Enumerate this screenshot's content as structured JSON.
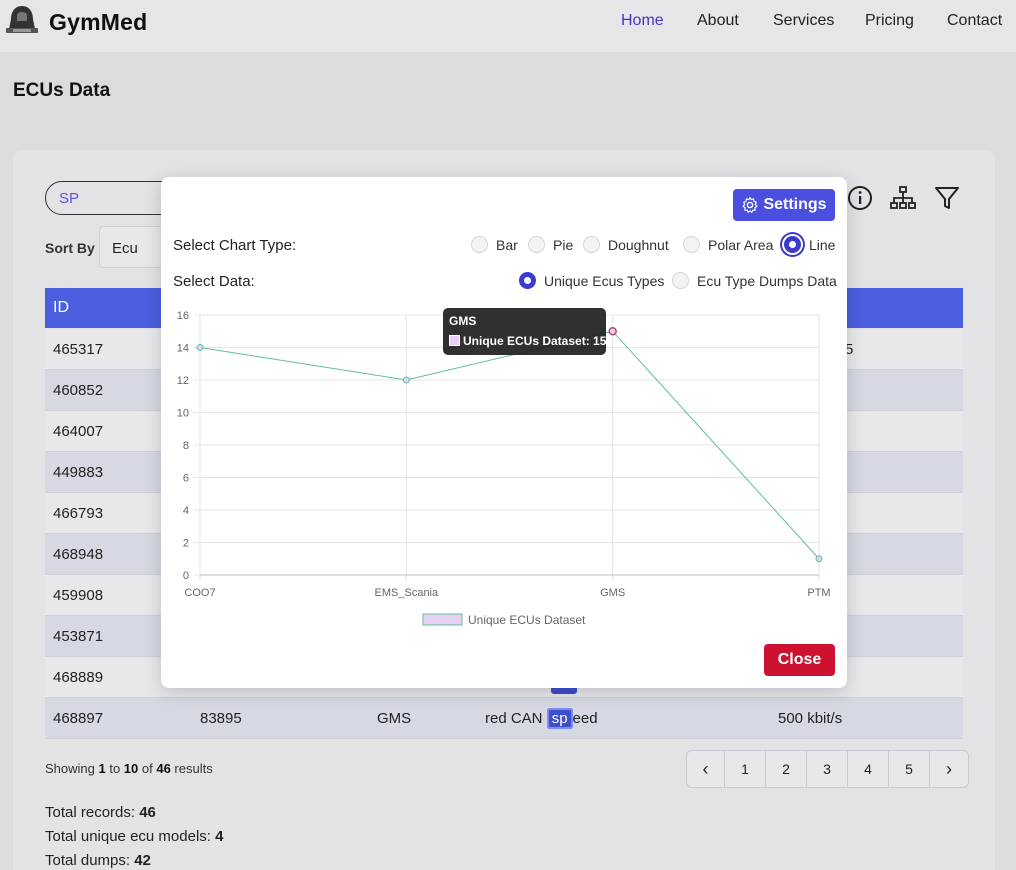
{
  "navbar": {
    "brand": "GymMed",
    "links": [
      "Home",
      "About",
      "Services",
      "Pricing",
      "Contact"
    ],
    "active": "Home"
  },
  "page": {
    "title": "ECUs Data"
  },
  "search": {
    "value": "SP"
  },
  "sort": {
    "label": "Sort By",
    "value": "Ecu"
  },
  "table": {
    "header_id": "ID",
    "rows": [
      {
        "id": "465317"
      },
      {
        "id": "460852"
      },
      {
        "id": "464007"
      },
      {
        "id": "449883"
      },
      {
        "id": "466793"
      },
      {
        "id": "468948"
      },
      {
        "id": "459908"
      },
      {
        "id": "453871"
      },
      {
        "id": "468889"
      },
      {
        "id": "468897",
        "col2": "83895",
        "ecu": "GMS",
        "desc_pre": "red CAN ",
        "desc_hl": "sp",
        "desc_post": "eed",
        "speed": "500 kbit/s"
      }
    ],
    "peek": {
      "row0": "5"
    }
  },
  "pagination": {
    "showing_prefix": "Showing ",
    "from": "1",
    "to_word": " to ",
    "to": "10",
    "of_word": " of ",
    "total": "46",
    "suffix": " results",
    "pages": [
      "1",
      "2",
      "3",
      "4",
      "5"
    ],
    "prev": "‹",
    "next": "›"
  },
  "stats": [
    {
      "label": "Total records: ",
      "value": "46"
    },
    {
      "label": "Total unique ecu models: ",
      "value": "4"
    },
    {
      "label": "Total dumps: ",
      "value": "42"
    }
  ],
  "modal": {
    "settings_label": "Settings",
    "chart_type_label": "Select Chart Type:",
    "chart_types": [
      "Bar",
      "Pie",
      "Doughnut",
      "Polar Area",
      "Line"
    ],
    "selected_chart_type": "Line",
    "data_label": "Select Data:",
    "data_options": [
      "Unique Ecus Types",
      "Ecu Type Dumps Data"
    ],
    "selected_data": "Unique Ecus Types",
    "close_label": "Close",
    "tooltip": {
      "title": "GMS",
      "body": "Unique ECUs Dataset: 15"
    }
  },
  "chart_data": {
    "type": "line",
    "categories": [
      "COO7",
      "EMS_Scania",
      "GMS",
      "PTM"
    ],
    "series": [
      {
        "name": "Unique ECUs Dataset",
        "values": [
          14,
          12,
          15,
          1
        ]
      }
    ],
    "ylim": [
      0,
      16
    ],
    "yticks": [
      "0",
      "2",
      "4",
      "6",
      "8",
      "10",
      "12",
      "14",
      "16"
    ],
    "grid": true,
    "legend": "bottom",
    "line_color": "#5fbf9d",
    "point_color": "#e6d0f3"
  }
}
